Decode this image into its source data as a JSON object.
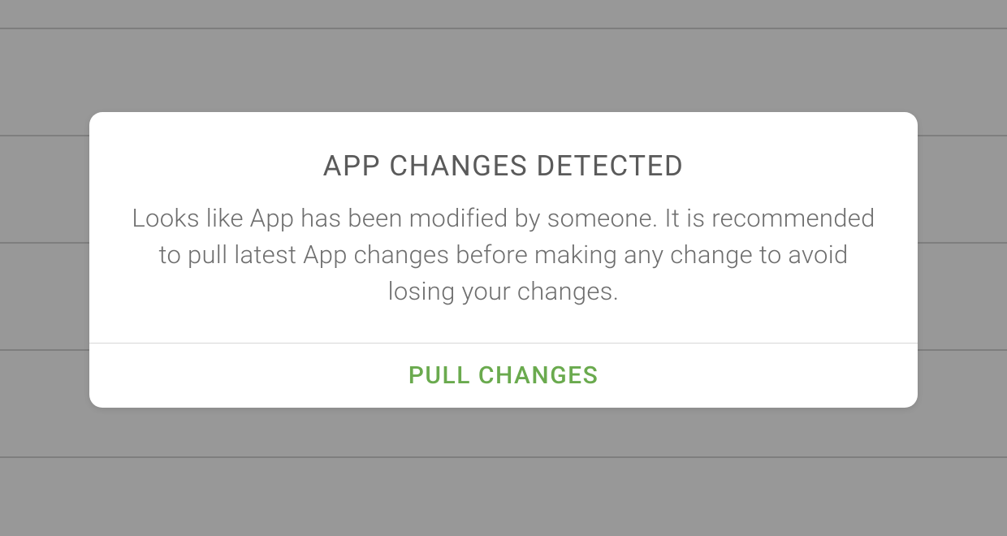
{
  "modal": {
    "title": "APP CHANGES DETECTED",
    "message": "Looks like App has been modified by someone. It is recommended to pull latest App changes before making any change to avoid losing your changes.",
    "action_label": "PULL CHANGES"
  }
}
